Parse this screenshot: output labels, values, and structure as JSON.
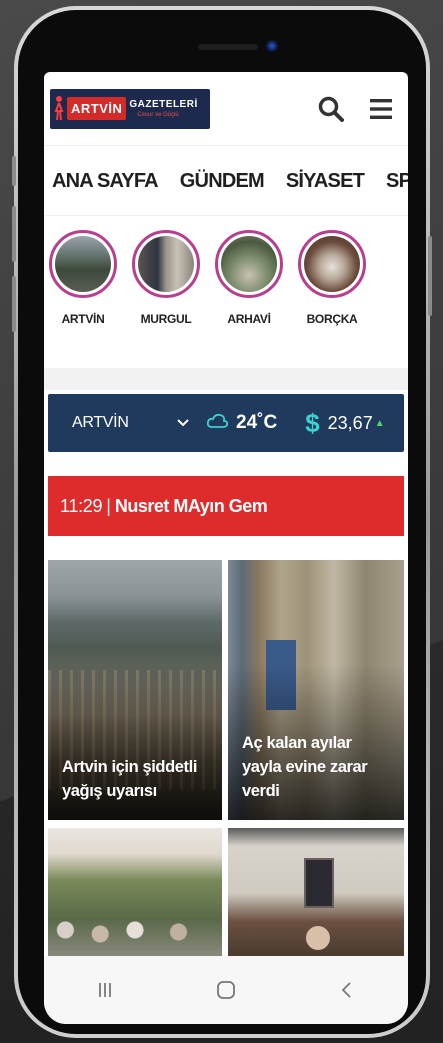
{
  "header": {
    "logo_brand": "ARTVİN",
    "logo_name": "GAZETELERİ",
    "logo_tagline": "Cesur ve Güçlü",
    "search_icon": "search-icon",
    "menu_icon": "hamburger-menu-icon"
  },
  "nav": {
    "items": [
      "ANA SAYFA",
      "GÜNDEM",
      "SİYASET",
      "SPOR"
    ]
  },
  "stories": [
    {
      "label": "ARTVİN"
    },
    {
      "label": "MURGUL"
    },
    {
      "label": "ARHAVİ"
    },
    {
      "label": "BORÇKA"
    }
  ],
  "weather": {
    "city": "ARTVİN",
    "temperature": "24˚C",
    "currency_symbol": "$",
    "rate": "23,67",
    "trend_icon": "up-arrow-icon"
  },
  "breaking": {
    "time": "11:29",
    "separator": "|",
    "title": "Nusret MAyın Gem"
  },
  "cards": [
    {
      "title": "Artvin için şiddetli yağış uyarısı"
    },
    {
      "title": "Aç kalan ayılar yayla evine zarar verdi"
    },
    {
      "title": ""
    },
    {
      "title": ""
    }
  ],
  "colors": {
    "brand_navy": "#1f3a5c",
    "breaking_red": "#de2c2c",
    "story_ring": "#b83f8e",
    "accent_teal": "#3fd0d0"
  },
  "system_nav": {
    "recent_icon": "recent-apps-icon",
    "home_icon": "home-icon",
    "back_icon": "back-icon"
  }
}
